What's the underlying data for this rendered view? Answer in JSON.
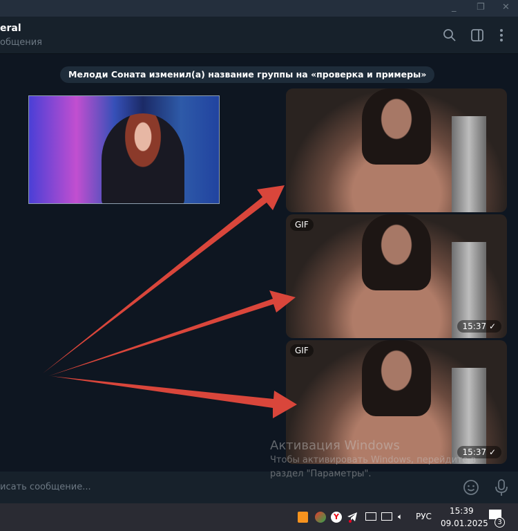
{
  "window": {
    "minimize": "_",
    "restore": "❐",
    "close": "✕"
  },
  "header": {
    "title": "eral",
    "subtitle": "общения"
  },
  "service_message": "Мелоди Соната изменил(а) название группы на «проверка и примеры»",
  "messages": [
    {
      "type": "gif",
      "badge": "",
      "time": ""
    },
    {
      "type": "gif",
      "badge": "GIF",
      "time": "15:37 ✓"
    },
    {
      "type": "gif",
      "badge": "GIF",
      "time": "15:37 ✓"
    }
  ],
  "watermark": {
    "title": "Активация Windows",
    "line1": "Чтобы активировать Windows, перейдите в",
    "line2": "раздел \"Параметры\"."
  },
  "composer": {
    "placeholder": "исать сообщение..."
  },
  "taskbar": {
    "lang": "РУС",
    "time": "15:39",
    "date": "09.01.2025",
    "notifications": "3"
  },
  "colors": {
    "arrow": "#d9463b",
    "accent": "#5288c1"
  }
}
